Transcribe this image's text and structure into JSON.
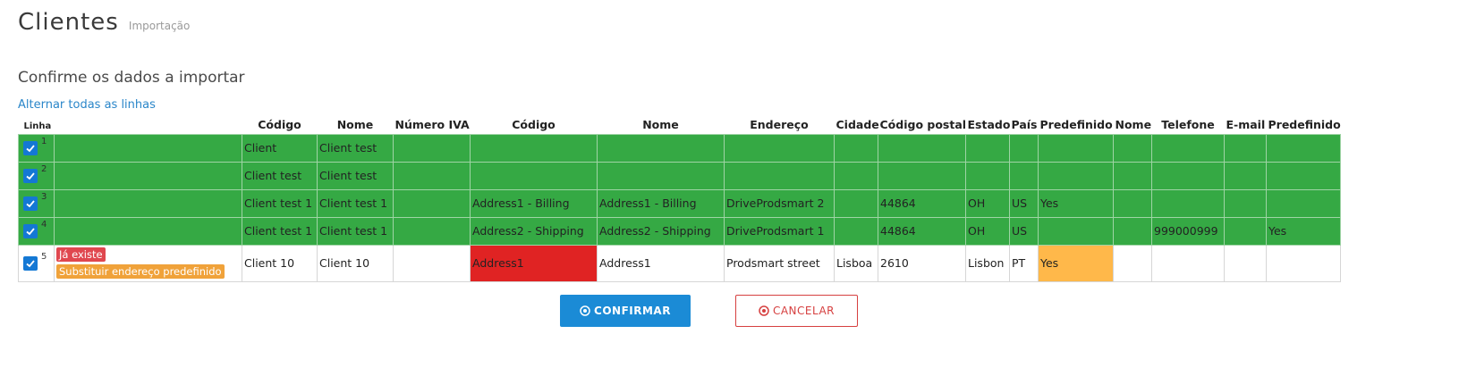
{
  "header": {
    "title": "Clientes",
    "subtitle": "Importação"
  },
  "section": {
    "title": "Confirme os dados a importar",
    "toggle_all": "Alternar todas as linhas"
  },
  "table": {
    "headers": [
      "Linha",
      "",
      "Código",
      "Nome",
      "Número IVA",
      "Código",
      "Nome",
      "Endereço",
      "Cidade",
      "Código postal",
      "Estado",
      "País",
      "Predefinido",
      "Nome",
      "Telefone",
      "E-mail",
      "Predefinido"
    ],
    "rows": [
      {
        "num": "1",
        "cells": [
          "Client",
          "Client test",
          "",
          "",
          "",
          "",
          "",
          "",
          "",
          "",
          "",
          "",
          "",
          "",
          ""
        ]
      },
      {
        "num": "2",
        "cells": [
          "Client test",
          "Client test",
          "",
          "",
          "",
          "",
          "",
          "",
          "",
          "",
          "",
          "",
          "",
          "",
          ""
        ]
      },
      {
        "num": "3",
        "cells": [
          "Client test 1",
          "Client test 1",
          "",
          "Address1 - Billing",
          "Address1 - Billing",
          "DriveProdsmart 2",
          "",
          "44864",
          "OH",
          "US",
          "Yes",
          "",
          "",
          "",
          ""
        ]
      },
      {
        "num": "4",
        "cells": [
          "Client test 1",
          "Client test 1",
          "",
          "Address2 - Shipping",
          "Address2 - Shipping",
          "DriveProdsmart 1",
          "",
          "44864",
          "OH",
          "US",
          "",
          "",
          "999000999",
          "",
          "Yes"
        ]
      },
      {
        "num": "5",
        "badges": [
          "Já existe",
          "Substituir endereço predefinido"
        ],
        "cells": [
          "Client 10",
          "Client 10",
          "",
          "Address1",
          "Address1",
          "Prodsmart street",
          "Lisboa",
          "2610",
          "Lisbon",
          "PT",
          "Yes",
          "",
          "",
          "",
          ""
        ]
      }
    ]
  },
  "buttons": {
    "confirm": "CONFIRMAR",
    "cancel": "CANCELAR"
  },
  "colors": {
    "ok_row": "#35a944",
    "error_cell": "#e02323",
    "warning_cell": "#ffb84a",
    "primary": "#1b8bd6",
    "danger": "#d64040"
  }
}
